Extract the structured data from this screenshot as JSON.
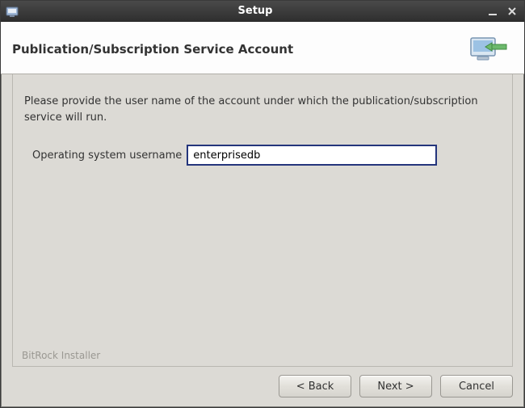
{
  "window": {
    "title": "Setup"
  },
  "header": {
    "title": "Publication/Subscription Service Account"
  },
  "content": {
    "instruction": "Please provide the user name of the account under which the publication/subscription service will run.",
    "username_label": "Operating system username",
    "username_value": "enterprisedb"
  },
  "branding": "BitRock Installer",
  "buttons": {
    "back": "< Back",
    "next": "Next >",
    "cancel": "Cancel"
  }
}
